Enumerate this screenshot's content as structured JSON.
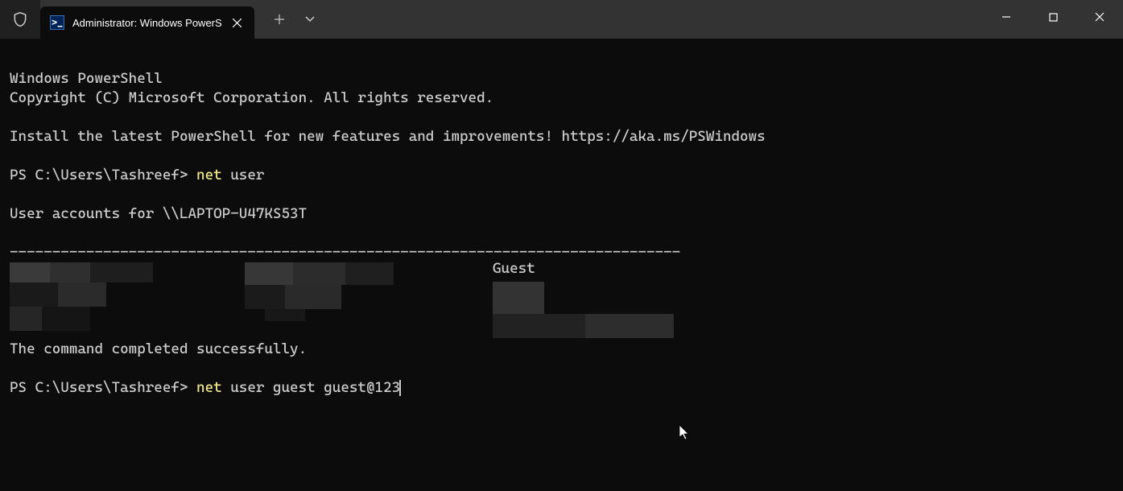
{
  "tab": {
    "title": "Administrator: Windows PowerS"
  },
  "terminal": {
    "header_line1": "Windows PowerShell",
    "header_line2": "Copyright (C) Microsoft Corporation. All rights reserved.",
    "install_hint": "Install the latest PowerShell for new features and improvements! https://aka.ms/PSWindows",
    "prompt1_prefix": "PS C:\\Users\\Tashreef> ",
    "prompt1_cmd": "net",
    "prompt1_rest": " user",
    "accounts_for": "User accounts for \\\\LAPTOP-U47KS53T",
    "separator": "-------------------------------------------------------------------------------",
    "guest_user": "Guest",
    "completed": "The command completed successfully.",
    "prompt2_prefix": "PS C:\\Users\\Tashreef> ",
    "prompt2_cmd": "net",
    "prompt2_rest": " user guest guest@123"
  }
}
